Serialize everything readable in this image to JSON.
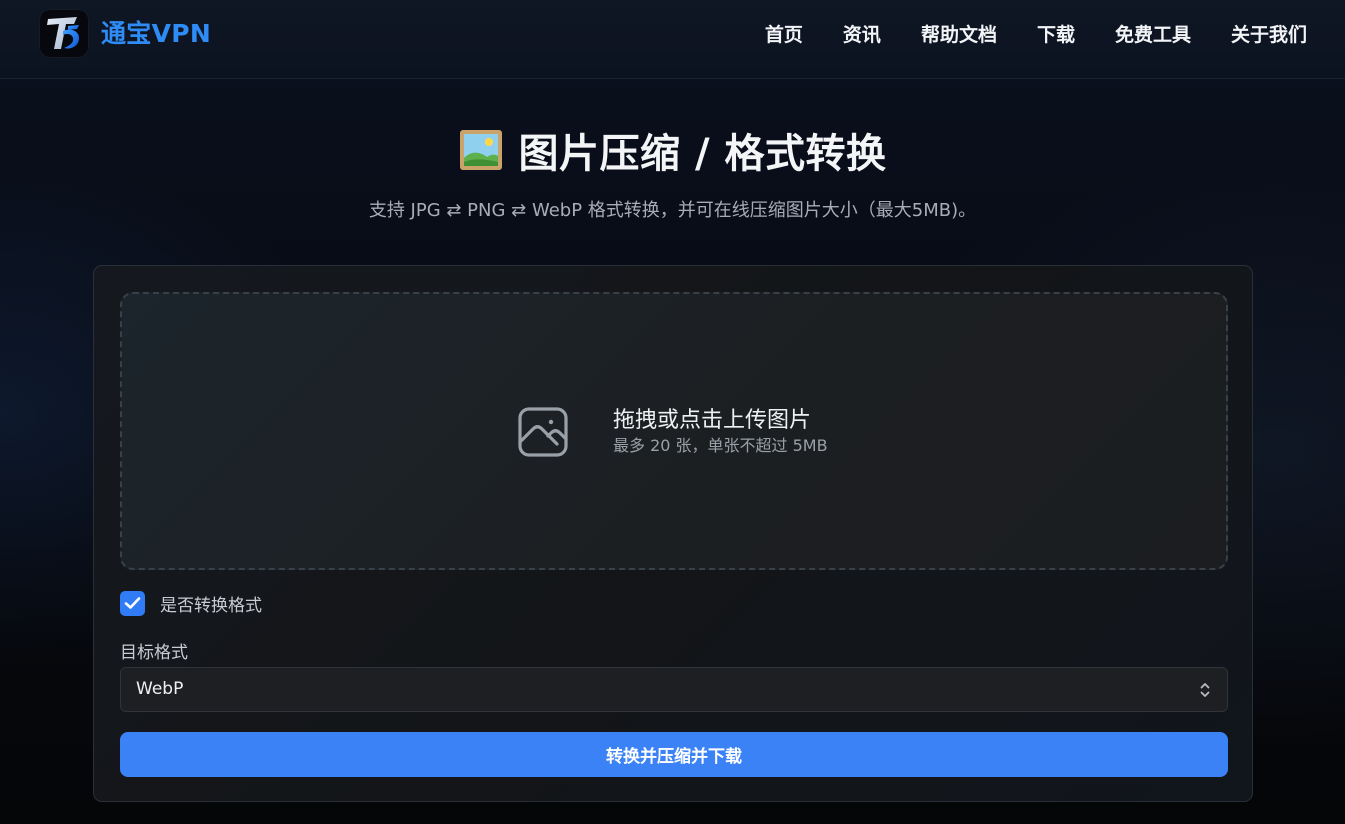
{
  "header": {
    "brand": "通宝VPN",
    "nav": [
      "首页",
      "资讯",
      "帮助文档",
      "下载",
      "免费工具",
      "关于我们"
    ]
  },
  "hero": {
    "icon": "framed-picture-icon",
    "title": "图片压缩 / 格式转换",
    "subtitle": "支持 JPG ⇄ PNG ⇄ WebP 格式转换，并可在线压缩图片大小（最大5MB)。"
  },
  "upload": {
    "icon": "image-icon",
    "title": "拖拽或点击上传图片",
    "hint": "最多 20 张，单张不超过 5MB"
  },
  "convert_option": {
    "label": "是否转换格式",
    "checked": true
  },
  "target_format": {
    "label": "目标格式",
    "value": "WebP"
  },
  "submit": {
    "label": "转换并压缩并下载"
  },
  "colors": {
    "brand": "#2f8bf5",
    "accent": "#3b82f6"
  }
}
